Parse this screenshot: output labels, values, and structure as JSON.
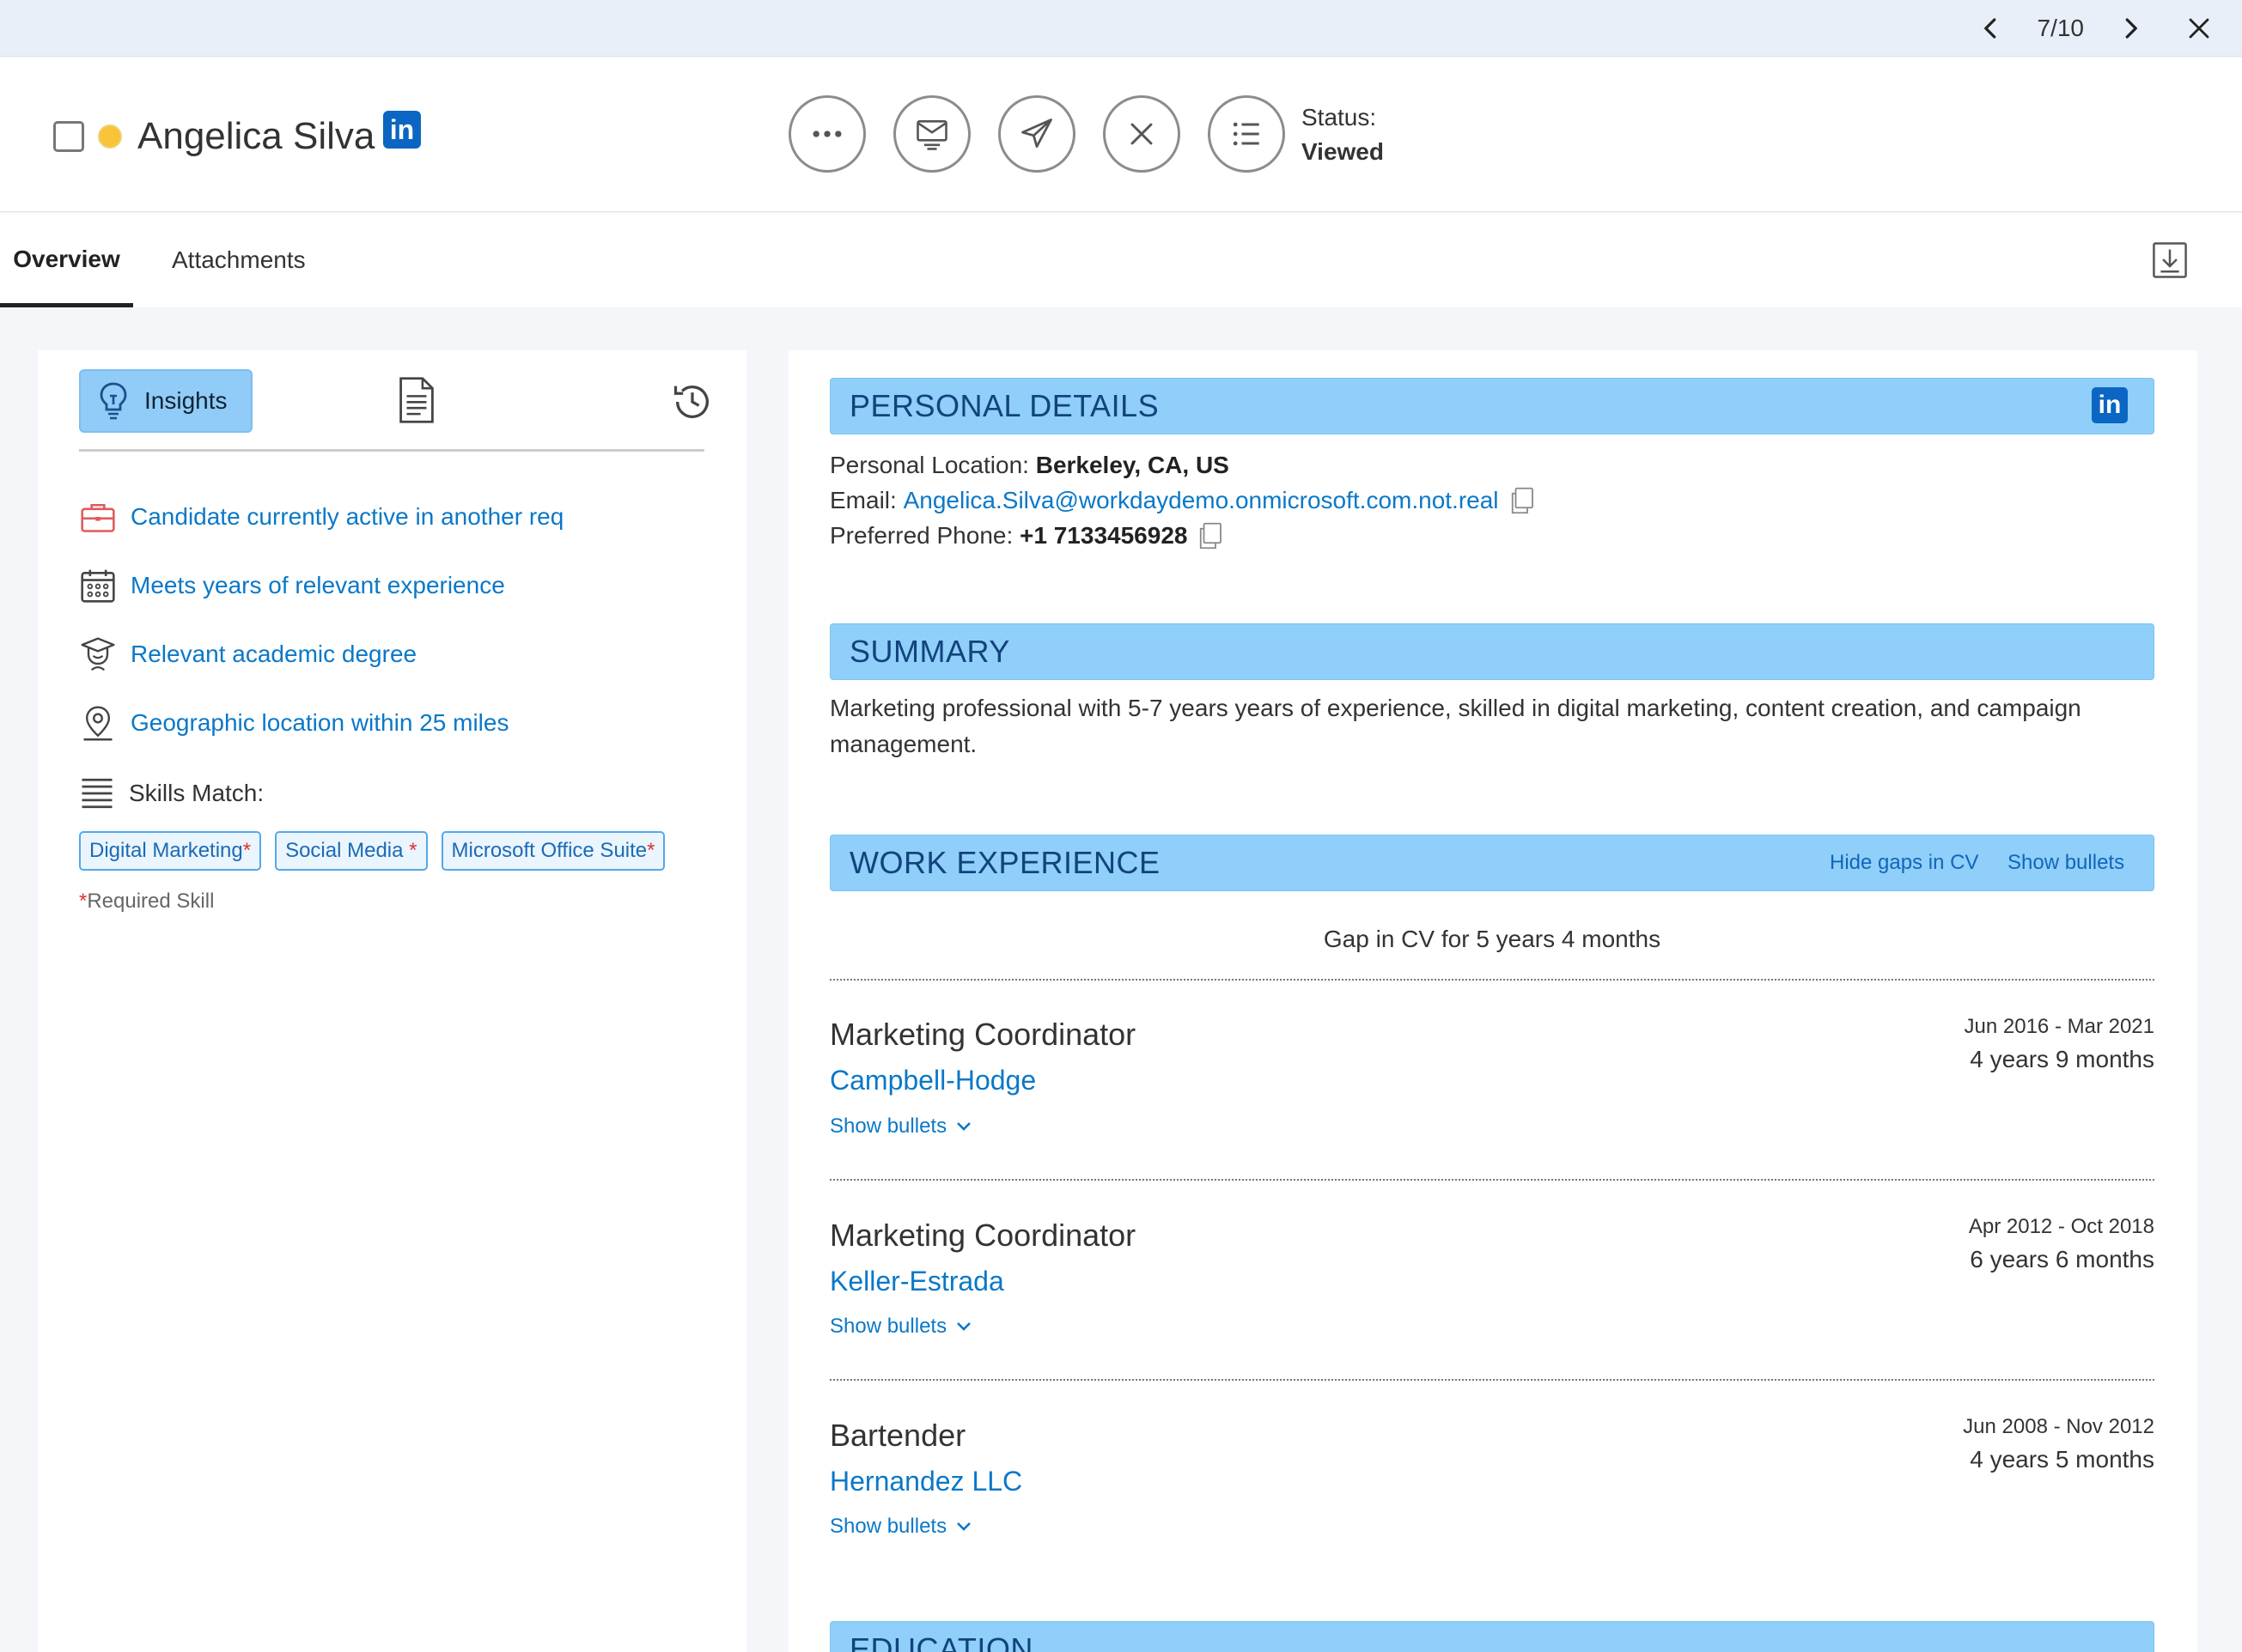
{
  "nav": {
    "counter": "7/10"
  },
  "candidate": {
    "name": "Angelica Silva",
    "linkedin_badge": "in"
  },
  "status": {
    "label": "Status:",
    "value": "Viewed"
  },
  "tabs": {
    "overview": "Overview",
    "attachments": "Attachments"
  },
  "insights": {
    "tab_label": "Insights",
    "items": [
      {
        "text": "Candidate currently active in another req",
        "icon": "briefcase-icon"
      },
      {
        "text": "Meets years of relevant experience",
        "icon": "calendar-icon"
      },
      {
        "text": "Relevant academic degree",
        "icon": "graduation-icon"
      },
      {
        "text": "Geographic location within 25 miles",
        "icon": "location-pin-icon"
      }
    ],
    "skills_label": "Skills Match:",
    "skills": [
      {
        "name": "Digital Marketing",
        "required": "*"
      },
      {
        "name": "Social Media ",
        "required": "*"
      },
      {
        "name": "Microsoft Office Suite",
        "required": "*"
      }
    ],
    "required_star": "*",
    "required_note": "Required Skill"
  },
  "personal": {
    "title": "PERSONAL DETAILS",
    "linkedin_badge": "in",
    "location_label": "Personal Location:",
    "location_value": "Berkeley, CA, US",
    "email_label": "Email:",
    "email_value": "Angelica.Silva@workdaydemo.onmicrosoft.com.not.real",
    "phone_label": "Preferred Phone:",
    "phone_value": "+1 7133456928"
  },
  "summary": {
    "title": "SUMMARY",
    "text": "Marketing professional with 5-7 years years of experience, skilled in digital marketing, content creation, and campaign management."
  },
  "work": {
    "title": "WORK EXPERIENCE",
    "hide_gaps": "Hide gaps in CV",
    "show_bullets": "Show bullets",
    "gap_text": "Gap in CV for 5 years 4 months",
    "jobs": [
      {
        "title": "Marketing Coordinator",
        "company": "Campbell-Hodge",
        "dates": "Jun 2016 - Mar 2021",
        "duration": "4 years 9 months",
        "bullets": "Show bullets"
      },
      {
        "title": "Marketing Coordinator",
        "company": "Keller-Estrada",
        "dates": "Apr 2012 - Oct 2018",
        "duration": "6 years 6 months",
        "bullets": "Show bullets"
      },
      {
        "title": "Bartender",
        "company": "Hernandez LLC",
        "dates": "Jun 2008 - Nov 2012",
        "duration": "4 years 5 months",
        "bullets": "Show bullets"
      }
    ]
  },
  "education": {
    "title": "EDUCATION"
  },
  "colors": {
    "accent": "#0a78c8",
    "section_header": "#8fcff9",
    "linkedin": "#0a66c2",
    "status_dot": "#f7c437"
  }
}
